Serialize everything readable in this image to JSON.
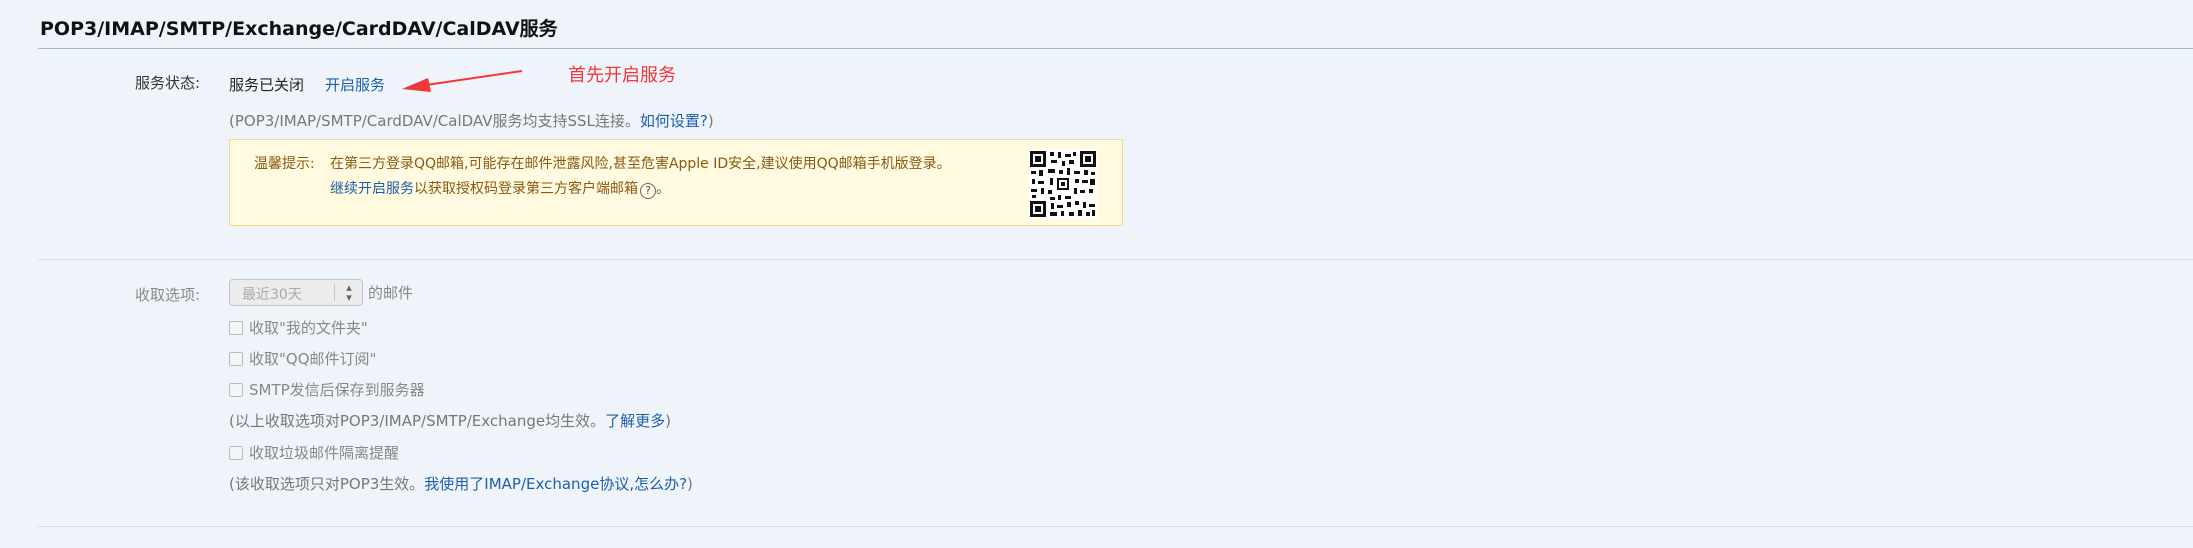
{
  "section": {
    "title": "POP3/IMAP/SMTP/Exchange/CardDAV/CalDAV服务"
  },
  "service": {
    "label": "服务状态:",
    "status": "服务已关闭",
    "enable_link": "开启服务",
    "note_prefix": "(POP3/IMAP/SMTP/CardDAV/CalDAV服务均支持SSL连接。",
    "note_link": "如何设置?",
    "note_suffix": ")"
  },
  "annotation": {
    "text": "首先开启服务",
    "color": "#f03838"
  },
  "tip": {
    "label": "温馨提示:",
    "line1": "在第三方登录QQ邮箱,可能存在邮件泄露风险,甚至危害Apple ID安全,建议使用QQ邮箱手机版登录。",
    "line2_link": "继续开启服务",
    "line2_text": "以获取授权码登录第三方客户端邮箱",
    "help_glyph": "?"
  },
  "fetch": {
    "label": "收取选项:",
    "range_value": "最近30天",
    "range_suffix": "的邮件",
    "option1": "收取\"我的文件夹\"",
    "option2": "收取\"QQ邮件订阅\"",
    "option3": "SMTP发信后保存到服务器",
    "note1_prefix": "(以上收取选项对POP3/IMAP/SMTP/Exchange均生效。",
    "note1_link": "了解更多",
    "note1_suffix": ")",
    "option4": "收取垃圾邮件隔离提醒",
    "note2_prefix": "(该收取选项只对POP3生效。",
    "note2_link": "我使用了IMAP/Exchange协议,怎么办?",
    "note2_suffix": ")"
  },
  "icons": {
    "qr": "qr-code",
    "help": "question-circle-icon",
    "select": "up-down-chevron-icon"
  }
}
